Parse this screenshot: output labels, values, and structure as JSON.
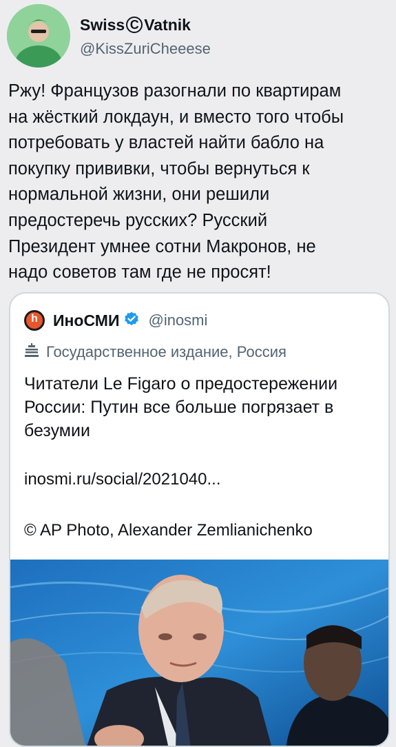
{
  "author": {
    "display_name_part1": "Swiss",
    "display_name_circle": "C",
    "display_name_part2": "Vatnik",
    "handle": "@KissZuriCheeese"
  },
  "tweet_text": "Ржу! Французов разогнали по квартирам\nна жёсткий локдаун, и вместо того чтобы\nпотребовать у властей найти бабло на\nпокупку прививки, чтобы вернуться к\nнормальной жизни, они решили\nпредостеречь русских? Русский\nПрезидент умнее сотни Макронов, не\nнадо советов там где не просят!",
  "quote": {
    "logo_letter": "h",
    "name": "ИноСМИ",
    "handle": "@inosmi",
    "label": "Государственное издание, Россия",
    "text": "Читатели Le Figaro о предостережении России: Путин все больше погрязает в безумии",
    "link": "inosmi.ru/social/2021040...",
    "credit": "© AP Photo, Alexander Zemlianichenko"
  },
  "colors": {
    "accent": "#1d9bf0",
    "secondary_text": "#536471",
    "border": "#cfd9de"
  },
  "icons": [
    "verified-badge-icon",
    "state-media-flag-icon"
  ]
}
